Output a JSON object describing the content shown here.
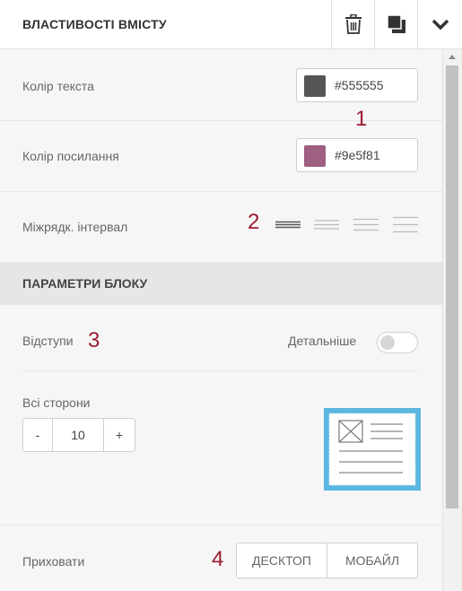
{
  "header": {
    "title": "ВЛАСТИВОСТІ ВМІСТУ",
    "buttons": [
      {
        "name": "delete-button",
        "icon": "trash-icon"
      },
      {
        "name": "duplicate-button",
        "icon": "copy-icon"
      },
      {
        "name": "collapse-button",
        "icon": "chevron-down-icon"
      }
    ]
  },
  "text_color": {
    "label": "Колір текста",
    "value": "#555555",
    "swatch": "#555555"
  },
  "link_color": {
    "label": "Колір посилання",
    "value": "#9e5f81",
    "swatch": "#9e5f81"
  },
  "line_spacing": {
    "label": "Міжрядк. інтервал",
    "options": [
      "compact",
      "normal",
      "relaxed",
      "loose"
    ],
    "selected": "compact"
  },
  "block_section": {
    "title": "ПАРАМЕТРИ БЛОКУ"
  },
  "padding": {
    "label": "Відступи",
    "detail_label": "Детальніше",
    "detail_enabled": false,
    "all_sides_label": "Всі сторони",
    "decrement": "-",
    "value": "10",
    "increment": "+"
  },
  "hide": {
    "label": "Приховати",
    "desktop": "ДЕСКТОП",
    "mobile": "МОБАЙЛ"
  },
  "markers": [
    "1",
    "2",
    "3",
    "4"
  ],
  "colors": {
    "accent": "#5bb7e0",
    "marker": "#9b1b30"
  }
}
